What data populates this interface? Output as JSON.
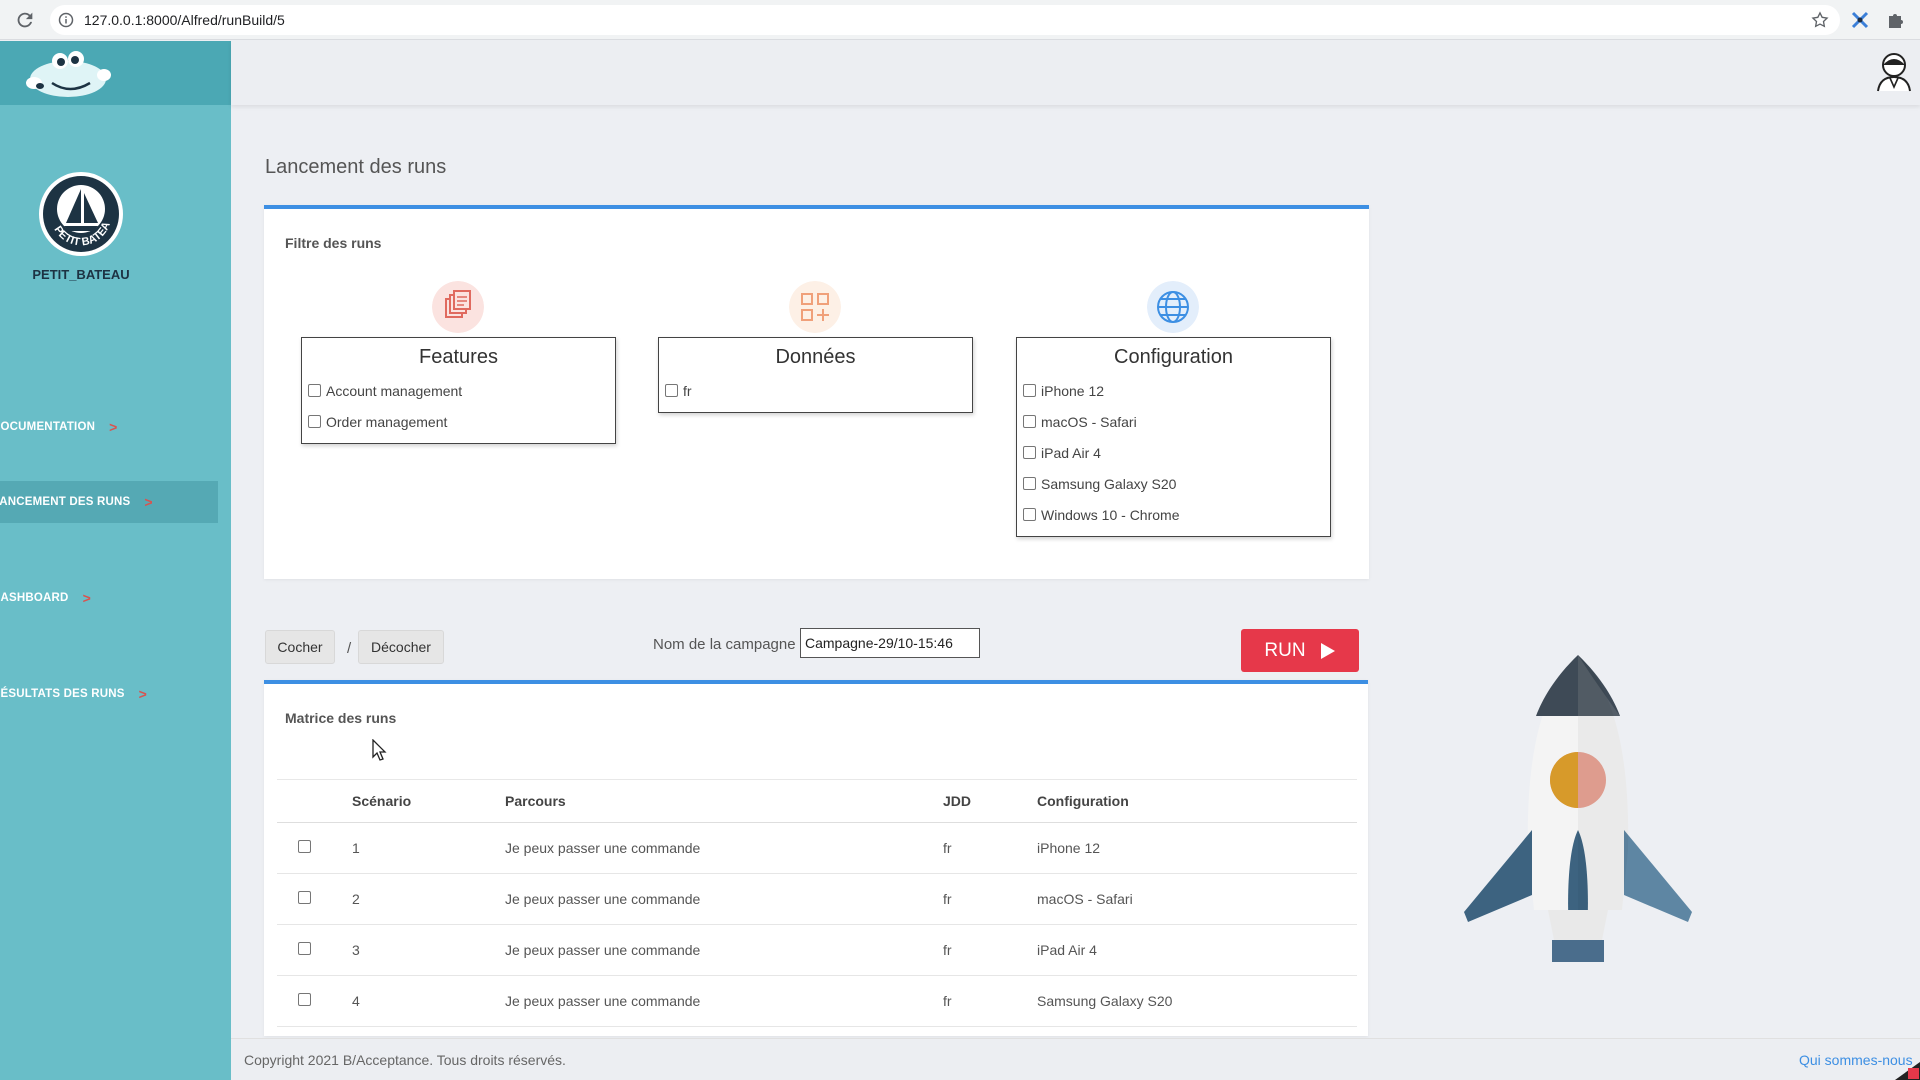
{
  "browser": {
    "url": "127.0.0.1:8000/Alfred/runBuild/5"
  },
  "sidebar": {
    "brand_name": "PETIT_BATEAU",
    "logo_text": "PETIT BATEAU",
    "items": [
      {
        "label": "DOCUMENTATION",
        "active": false
      },
      {
        "label": "LANCEMENT DES RUNS",
        "active": true
      },
      {
        "label": "DASHBOARD",
        "active": false
      },
      {
        "label": "RÉSULTATS DES RUNS",
        "active": false
      }
    ],
    "chevron": ">"
  },
  "page": {
    "title": "Lancement des runs"
  },
  "filters": {
    "card_title": "Filtre des runs",
    "features": {
      "title": "Features",
      "icon": "documents-icon",
      "options": [
        "Account management",
        "Order management"
      ]
    },
    "donnees": {
      "title": "Données",
      "icon": "grid-plus-icon",
      "options": [
        "fr"
      ]
    },
    "configuration": {
      "title": "Configuration",
      "icon": "globe-icon",
      "options": [
        "iPhone 12",
        "macOS - Safari",
        "iPad Air 4",
        "Samsung Galaxy S20",
        "Windows 10 - Chrome"
      ]
    }
  },
  "actions": {
    "check_label": "Cocher",
    "separator": "/",
    "uncheck_label": "Décocher",
    "campaign_label": "Nom de la campagne",
    "campaign_value": "Campagne-29/10-15:46",
    "run_label": "RUN"
  },
  "matrix": {
    "title": "Matrice des runs",
    "headers": {
      "scenario": "Scénario",
      "parcours": "Parcours",
      "jdd": "JDD",
      "configuration": "Configuration"
    },
    "rows": [
      {
        "scenario": "1",
        "parcours": "Je peux passer une commande",
        "jdd": "fr",
        "configuration": "iPhone 12"
      },
      {
        "scenario": "2",
        "parcours": "Je peux passer une commande",
        "jdd": "fr",
        "configuration": "macOS - Safari"
      },
      {
        "scenario": "3",
        "parcours": "Je peux passer une commande",
        "jdd": "fr",
        "configuration": "iPad Air 4"
      },
      {
        "scenario": "4",
        "parcours": "Je peux passer une commande",
        "jdd": "fr",
        "configuration": "Samsung Galaxy S20"
      }
    ]
  },
  "footer": {
    "copyright": "Copyright 2021 B/Acceptance. Tous droits réservés.",
    "about_link": "Qui sommes-nous"
  },
  "colors": {
    "sidebar": "#69bec8",
    "sidebar_header": "#4ba8b4",
    "accent_blue": "#3d8fe3",
    "run_red": "#e6384a"
  }
}
